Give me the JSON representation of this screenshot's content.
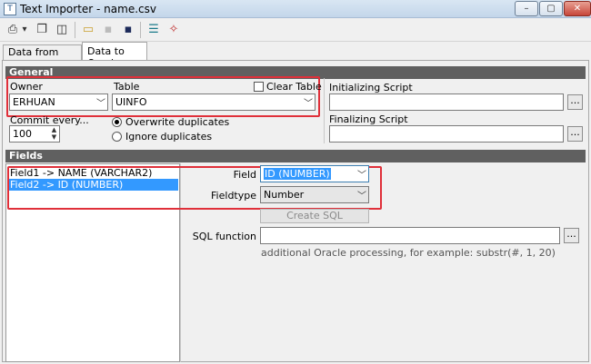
{
  "window": {
    "title": "Text Importer - name.csv",
    "app_icon": "T",
    "min": "–",
    "max": "▢",
    "close": "✕"
  },
  "toolbar_icons": [
    "printer-icon",
    "dropdown-arrow-icon",
    "copy-icon",
    "new-icon",
    "open-folder-icon",
    "save-disabled-icon",
    "save-icon",
    "database-icon",
    "magic-wand-icon"
  ],
  "toolbar_glyphs": {
    "print": "⎙",
    "arrow": "▾",
    "copy": "❐",
    "new": "◫",
    "open": "▭",
    "save_dis": "▪",
    "save": "▪",
    "db": "☰",
    "wand": "✧"
  },
  "tabs": [
    {
      "label": "Data from Textfile"
    },
    {
      "label": "Data to Oracle"
    }
  ],
  "general": {
    "heading": "General",
    "owner_label": "Owner",
    "owner_value": "ERHUAN",
    "table_label": "Table",
    "table_value": "UINFO",
    "clear_table_label": "Clear Table",
    "commit_label": "Commit every...",
    "commit_value": "100",
    "overwrite_label": "Overwrite duplicates",
    "ignore_label": "Ignore duplicates",
    "init_script_label": "Initializing Script",
    "final_script_label": "Finalizing Script",
    "ellipsis": "..."
  },
  "fields": {
    "heading": "Fields",
    "mappings": [
      "Field1  ->  NAME (VARCHAR2)",
      "Field2  ->  ID (NUMBER)"
    ],
    "field_label": "Field",
    "field_value": "ID (NUMBER)",
    "fieldtype_label": "Fieldtype",
    "fieldtype_value": "Number",
    "create_sql_label": "Create SQL",
    "sql_function_label": "SQL function",
    "sql_hint": "additional Oracle processing, for example: substr(#, 1, 20)",
    "ellipsis": "..."
  },
  "colors": {
    "highlight": "#e0303a",
    "selection": "#3399ff"
  }
}
